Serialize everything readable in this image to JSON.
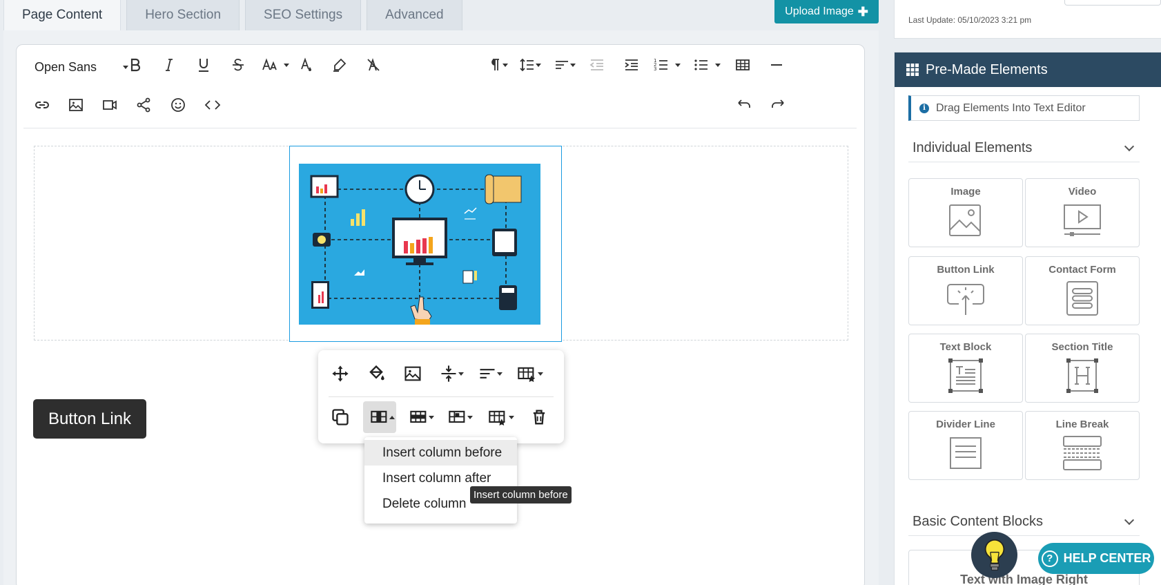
{
  "tabs": [
    {
      "label": "Page Content",
      "active": true
    },
    {
      "label": "Hero Section"
    },
    {
      "label": "SEO Settings"
    },
    {
      "label": "Advanced"
    }
  ],
  "upload": {
    "label": "Upload Image",
    "icon": "plus-icon"
  },
  "editor": {
    "font_family": "Open Sans",
    "toolbar_row1": [
      "bold-icon",
      "italic-icon",
      "underline-icon",
      "strikethrough-icon",
      "font-size-icon",
      "text-color-icon",
      "highlight-icon",
      "clear-format-icon",
      "paragraph-format-icon",
      "line-height-icon",
      "align-icon",
      "outdent-icon",
      "indent-icon",
      "ordered-list-icon",
      "unordered-list-icon",
      "table-icon",
      "horizontal-line-icon"
    ],
    "toolbar_row2": [
      "link-icon",
      "image-icon",
      "video-icon",
      "share-icon",
      "emoticon-icon",
      "code-view-icon",
      "undo-icon",
      "redo-icon"
    ],
    "button_link": "Button Link"
  },
  "table_popup": {
    "row1": [
      "move-icon",
      "cell-background-icon",
      "insert-image-icon",
      "vertical-align-icon",
      "horizontal-align-icon",
      "table-style-icon"
    ],
    "row2": [
      "copy-icon",
      "column-icon",
      "row-icon",
      "merge-cells-icon",
      "cell-style-icon",
      "delete-table-icon"
    ],
    "dropdown": [
      "Insert column before",
      "Insert column after",
      "Delete column"
    ],
    "tooltip": "Insert column before"
  },
  "sidebar": {
    "last_update": "Last Update: 05/10/2023 3:21 pm",
    "premade_title": "Pre-Made Elements",
    "hint": "Drag Elements Into Text Editor",
    "individual_title": "Individual Elements",
    "elements": [
      {
        "label": "Image",
        "icon": "image-icon"
      },
      {
        "label": "Video",
        "icon": "video-icon"
      },
      {
        "label": "Button Link",
        "icon": "button-link-icon"
      },
      {
        "label": "Contact Form",
        "icon": "contact-form-icon"
      },
      {
        "label": "Text Block",
        "icon": "text-block-icon"
      },
      {
        "label": "Section Title",
        "icon": "section-title-icon"
      },
      {
        "label": "Divider Line",
        "icon": "divider-line-icon"
      },
      {
        "label": "Line Break",
        "icon": "line-break-icon"
      }
    ],
    "basic_title": "Basic Content Blocks",
    "partial_block": "Text with Image Right"
  },
  "help": {
    "label": "HELP CENTER"
  }
}
